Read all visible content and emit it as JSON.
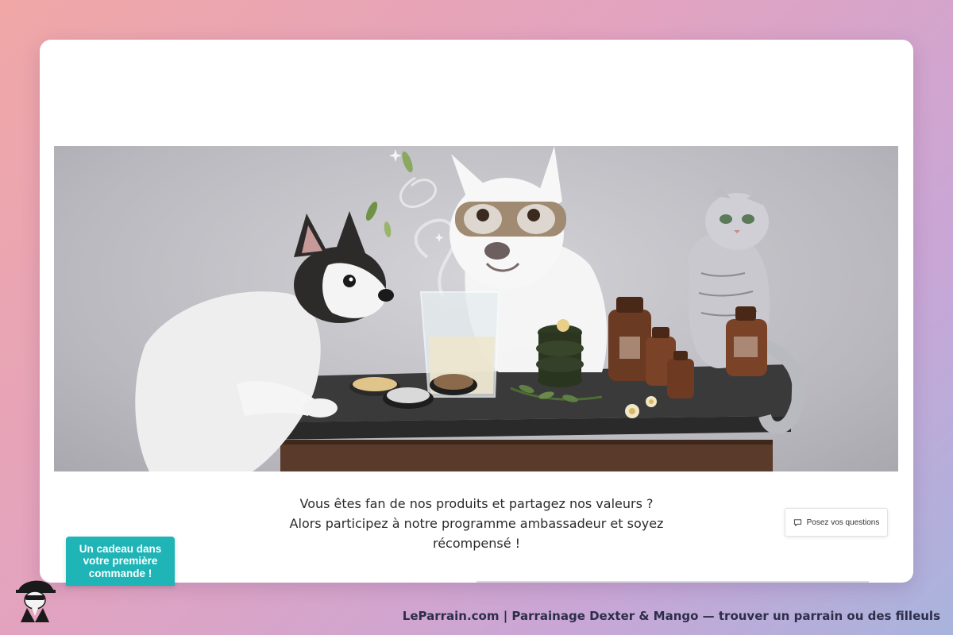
{
  "hero": {
    "image_description_name": "hero-illustration"
  },
  "intro": {
    "line1": "Vous êtes fan de nos produits et partagez nos valeurs ?",
    "line2": "Alors participez à notre programme ambassadeur et soyez",
    "line3": "récompensé !"
  },
  "questions_button": {
    "label": "Posez vos questions",
    "icon": "chat-bubble-icon"
  },
  "gift_button": {
    "label": "Un cadeau dans votre première commande !"
  },
  "footer": {
    "text": "LeParrain.com | Parrainage Dexter & Mango — trouver un parrain ou des filleuls",
    "logo_icon": "spy-mascot-icon"
  },
  "colors": {
    "background_start": "#f0a7a6",
    "background_end": "#a8b4dd",
    "gift_button": "#1fb4b6",
    "footer_text": "#2e2e4a"
  }
}
